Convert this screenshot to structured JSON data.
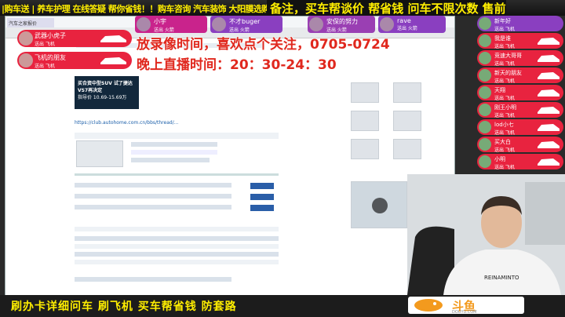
{
  "ticker": {
    "left": "|购车送 | 养车护理 在线答疑 帮你省钱！！购车咨询 汽车装饰 大阳膜选购 底盘装甲 拍砖抛光 漆面养护 打",
    "right": "备注，买车帮谈价 帮省钱 问车不限次数 售前"
  },
  "overlay": {
    "line1": "放录像时间，喜欢点个关注，0705-0724",
    "line2": "晚上直播时间：20：30-24：30"
  },
  "browser": {
    "tab": "汽车之家报价",
    "ad_text": "买合资中型SUV 试了捷达VS7再决定",
    "ad_price": "指导价 10.69-15.69万",
    "url": "https://club.autohome.com.cn/bbs/thread/..."
  },
  "left_badges": [
    {
      "name": "武器小虎子",
      "sub": "送出 飞机"
    },
    {
      "name": "飞机的朋友",
      "sub": "送出 飞机"
    }
  ],
  "top_gifts": [
    {
      "name": "小宇",
      "sub": "送出 火箭"
    },
    {
      "name": "不才buger",
      "sub": "送出 火箭"
    },
    {
      "name": "安保的努力",
      "sub": "送出 火箭"
    },
    {
      "name": "rave",
      "sub": "送出 火箭"
    },
    {
      "name": "新年好好",
      "sub": "送出 飞机"
    }
  ],
  "sidebar_gifts": [
    {
      "name": "新年好",
      "sub": "送出 飞机"
    },
    {
      "name": "我是谁",
      "sub": "送出 飞机"
    },
    {
      "name": "竞速大哥哥",
      "sub": "送出 飞机"
    },
    {
      "name": "新天的朋友",
      "sub": "送出 飞机"
    },
    {
      "name": "天翔",
      "sub": "送出 飞机"
    },
    {
      "name": "刚王小明",
      "sub": "送出 飞机"
    },
    {
      "name": "lod小七",
      "sub": "送出 飞机"
    },
    {
      "name": "买大白",
      "sub": "送出 飞机"
    },
    {
      "name": "小明",
      "sub": "送出 飞机"
    }
  ],
  "bottom_text": "刷办卡详细问车    刷飞机 买车帮省钱 防套路",
  "logo": {
    "name": "斗鱼",
    "url": "DOUYU.COM"
  },
  "colors": {
    "accent_red": "#e8233f",
    "ticker_yellow": "#ffee00",
    "overlay_red": "#e0281e",
    "brand_orange": "#f39a1e"
  }
}
